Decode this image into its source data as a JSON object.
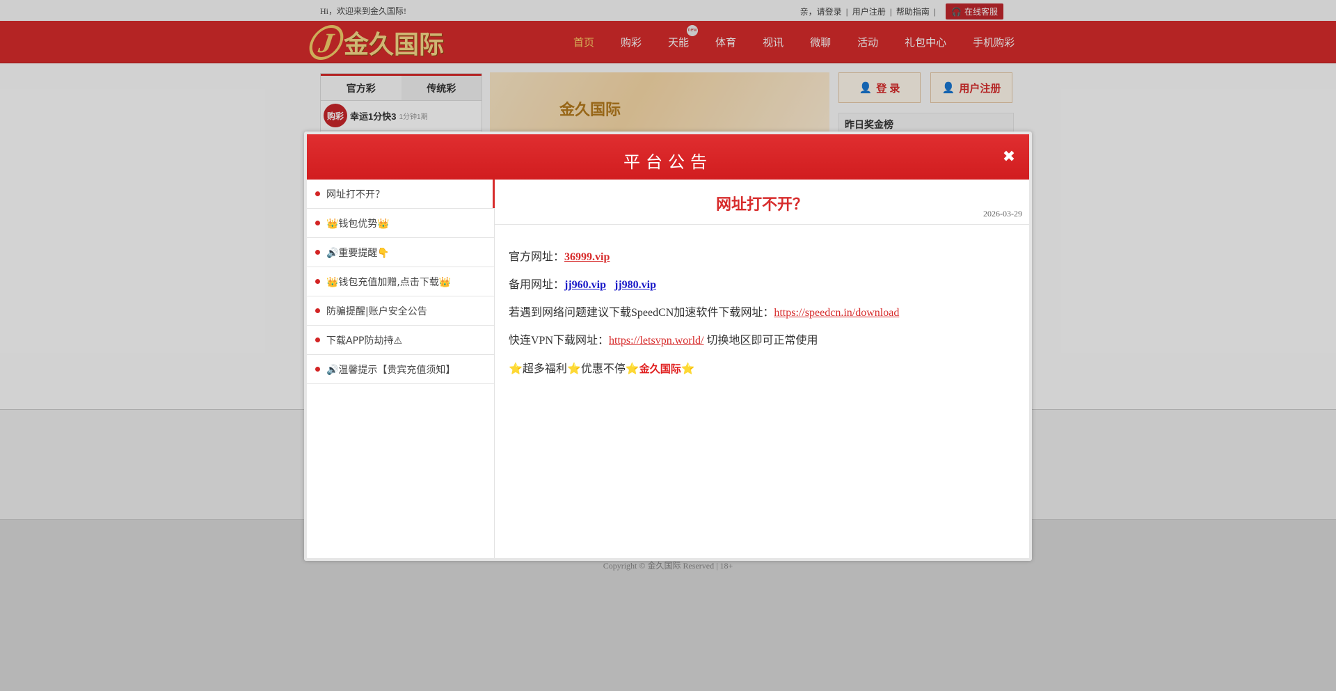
{
  "topbar": {
    "welcome": "Hi，欢迎来到金久国际!",
    "login_prompt": "亲，请登录",
    "register": "用户注册",
    "help": "帮助指南",
    "service": "在线客服"
  },
  "brand": {
    "name": "金久国际",
    "logo_letter": "J"
  },
  "nav": {
    "items": [
      "首页",
      "购彩",
      "天能",
      "体育",
      "视讯",
      "微聊",
      "活动",
      "礼包中心",
      "手机购彩"
    ],
    "badge": "new"
  },
  "lottery_panel": {
    "tabs": [
      "官方彩",
      "传统彩"
    ],
    "items": [
      {
        "name": "幸运1分快3",
        "sub": "1分钟1期",
        "icon_text": "购彩"
      }
    ]
  },
  "banner": {
    "brand_text": "金久国际"
  },
  "account_buttons": {
    "login": "登 录",
    "register": "用户注册"
  },
  "ranking": {
    "title": "昨日奖金榜"
  },
  "footer": {
    "copyright": "Copyright © 金久国际 Reserved | 18+"
  },
  "modal": {
    "title": "平台公告",
    "close_symbol": "✖",
    "notices": [
      "网址打不开？",
      "👑钱包优势👑",
      "🔊重要提醒👇",
      "👑钱包充值加赠,点击下载👑",
      "防骗提醒|账户安全公告",
      "下载APP防劫持⚠",
      "🔊温馨提示【贵宾充值须知】"
    ],
    "article": {
      "title": "网址打不开？",
      "date": "2026-03-29",
      "official_label": "官方网址：",
      "official_url": "36999.vip",
      "backup_label": "备用网址：",
      "backup_urls": [
        "jj960.vip",
        "jj980.vip"
      ],
      "speed_text": "若遇到网络问题建议下载SpeedCN加速软件下载网址：",
      "speed_url": "https://speedcn.in/download",
      "vpn_label": "快连VPN下载网址：",
      "vpn_url": "https://letsvpn.world/",
      "vpn_suffix": " 切换地区即可正常使用",
      "promo_1": "超多福利",
      "promo_2": "优惠不停",
      "promo_brand": "金久国际",
      "star": "⭐"
    }
  }
}
